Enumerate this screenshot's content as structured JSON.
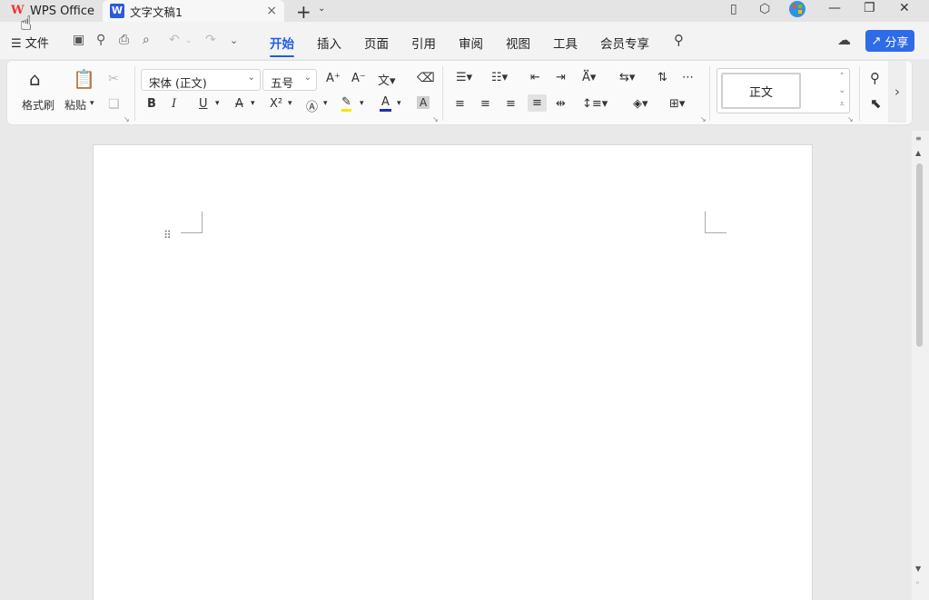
{
  "titlebar": {
    "app_tab": "WPS Office",
    "doc_tab": "文字文稿1",
    "doc_icon": "W",
    "close": "×",
    "new_tab": "+",
    "dropdown": "⌄"
  },
  "menubar": {
    "file": "☰ 文件",
    "tabs": [
      "开始",
      "插入",
      "页面",
      "引用",
      "审阅",
      "视图",
      "工具",
      "会员专享"
    ],
    "active_tab": "开始",
    "share": "分享"
  },
  "ribbon": {
    "format_painter": "格式刷",
    "paste": "粘贴",
    "font_name": "宋体 (正文)",
    "font_size": "五号",
    "style_current": "正文"
  },
  "colors": {
    "accent": "#1f5ce6",
    "share_bg": "#2e6be6",
    "highlight": "#f5e600",
    "font_color": "#1f2dbb",
    "wps_logo": "#e33333"
  }
}
